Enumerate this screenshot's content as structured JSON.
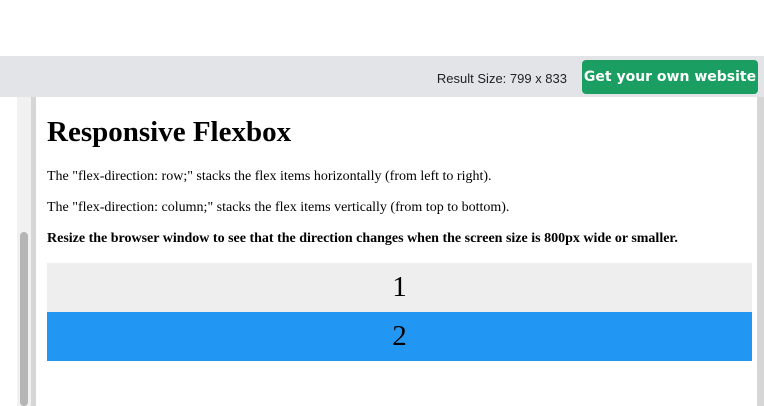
{
  "toolbar": {
    "result_size": "Result Size: 799 x 833",
    "get_website_label": "Get your own website"
  },
  "result": {
    "title": "Responsive Flexbox",
    "paragraph_1": "The \"flex-direction: row;\" stacks the flex items horizontally (from left to right).",
    "paragraph_2": "The \"flex-direction: column;\" stacks the flex items vertically (from top to bottom).",
    "paragraph_3": "Resize the browser window to see that the direction changes when the screen size is 800px wide or smaller.",
    "flex_items": [
      "1",
      "2"
    ]
  },
  "colors": {
    "button_bg": "#1a9e62",
    "toolbar_bg": "#e3e4e8",
    "flex_item_1_bg": "#eeeeee",
    "flex_item_2_bg": "#2196f3"
  }
}
